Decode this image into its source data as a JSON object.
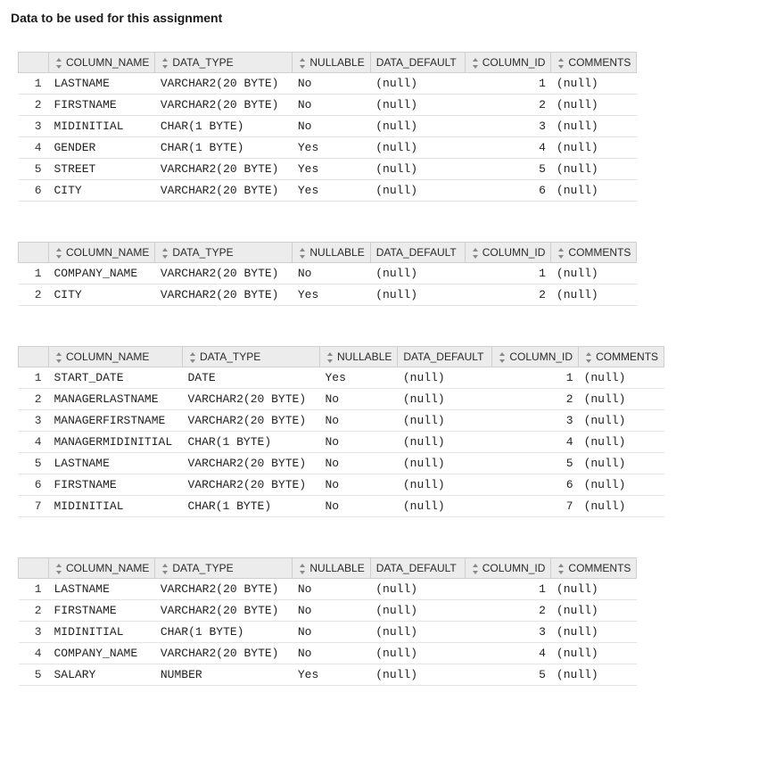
{
  "page_title": "Data to be used for this assignment",
  "headers": {
    "column_name": "COLUMN_NAME",
    "data_type": "DATA_TYPE",
    "nullable": "NULLABLE",
    "data_default": "DATA_DEFAULT",
    "column_id": "COLUMN_ID",
    "comments": "COMMENTS"
  },
  "tables": [
    {
      "rows": [
        {
          "n": "1",
          "name": "LASTNAME",
          "type": "VARCHAR2(20 BYTE)",
          "nullable": "No",
          "default": "(null)",
          "id": "1",
          "comments": "(null)"
        },
        {
          "n": "2",
          "name": "FIRSTNAME",
          "type": "VARCHAR2(20 BYTE)",
          "nullable": "No",
          "default": "(null)",
          "id": "2",
          "comments": "(null)"
        },
        {
          "n": "3",
          "name": "MIDINITIAL",
          "type": "CHAR(1 BYTE)",
          "nullable": "No",
          "default": "(null)",
          "id": "3",
          "comments": "(null)"
        },
        {
          "n": "4",
          "name": "GENDER",
          "type": "CHAR(1 BYTE)",
          "nullable": "Yes",
          "default": "(null)",
          "id": "4",
          "comments": "(null)"
        },
        {
          "n": "5",
          "name": "STREET",
          "type": "VARCHAR2(20 BYTE)",
          "nullable": "Yes",
          "default": "(null)",
          "id": "5",
          "comments": "(null)"
        },
        {
          "n": "6",
          "name": "CITY",
          "type": "VARCHAR2(20 BYTE)",
          "nullable": "Yes",
          "default": "(null)",
          "id": "6",
          "comments": "(null)"
        }
      ]
    },
    {
      "rows": [
        {
          "n": "1",
          "name": "COMPANY_NAME",
          "type": "VARCHAR2(20 BYTE)",
          "nullable": "No",
          "default": "(null)",
          "id": "1",
          "comments": "(null)"
        },
        {
          "n": "2",
          "name": "CITY",
          "type": "VARCHAR2(20 BYTE)",
          "nullable": "Yes",
          "default": "(null)",
          "id": "2",
          "comments": "(null)"
        }
      ]
    },
    {
      "rows": [
        {
          "n": "1",
          "name": "START_DATE",
          "type": "DATE",
          "nullable": "Yes",
          "default": "(null)",
          "id": "1",
          "comments": "(null)"
        },
        {
          "n": "2",
          "name": "MANAGERLASTNAME",
          "type": "VARCHAR2(20 BYTE)",
          "nullable": "No",
          "default": "(null)",
          "id": "2",
          "comments": "(null)"
        },
        {
          "n": "3",
          "name": "MANAGERFIRSTNAME",
          "type": "VARCHAR2(20 BYTE)",
          "nullable": "No",
          "default": "(null)",
          "id": "3",
          "comments": "(null)"
        },
        {
          "n": "4",
          "name": "MANAGERMIDINITIAL",
          "type": "CHAR(1 BYTE)",
          "nullable": "No",
          "default": "(null)",
          "id": "4",
          "comments": "(null)"
        },
        {
          "n": "5",
          "name": "LASTNAME",
          "type": "VARCHAR2(20 BYTE)",
          "nullable": "No",
          "default": "(null)",
          "id": "5",
          "comments": "(null)"
        },
        {
          "n": "6",
          "name": "FIRSTNAME",
          "type": "VARCHAR2(20 BYTE)",
          "nullable": "No",
          "default": "(null)",
          "id": "6",
          "comments": "(null)"
        },
        {
          "n": "7",
          "name": "MIDINITIAL",
          "type": "CHAR(1 BYTE)",
          "nullable": "No",
          "default": "(null)",
          "id": "7",
          "comments": "(null)"
        }
      ]
    },
    {
      "rows": [
        {
          "n": "1",
          "name": "LASTNAME",
          "type": "VARCHAR2(20 BYTE)",
          "nullable": "No",
          "default": "(null)",
          "id": "1",
          "comments": "(null)"
        },
        {
          "n": "2",
          "name": "FIRSTNAME",
          "type": "VARCHAR2(20 BYTE)",
          "nullable": "No",
          "default": "(null)",
          "id": "2",
          "comments": "(null)"
        },
        {
          "n": "3",
          "name": "MIDINITIAL",
          "type": "CHAR(1 BYTE)",
          "nullable": "No",
          "default": "(null)",
          "id": "3",
          "comments": "(null)"
        },
        {
          "n": "4",
          "name": "COMPANY_NAME",
          "type": "VARCHAR2(20 BYTE)",
          "nullable": "No",
          "default": "(null)",
          "id": "4",
          "comments": "(null)"
        },
        {
          "n": "5",
          "name": "SALARY",
          "type": "NUMBER",
          "nullable": "Yes",
          "default": "(null)",
          "id": "5",
          "comments": "(null)"
        }
      ]
    }
  ]
}
